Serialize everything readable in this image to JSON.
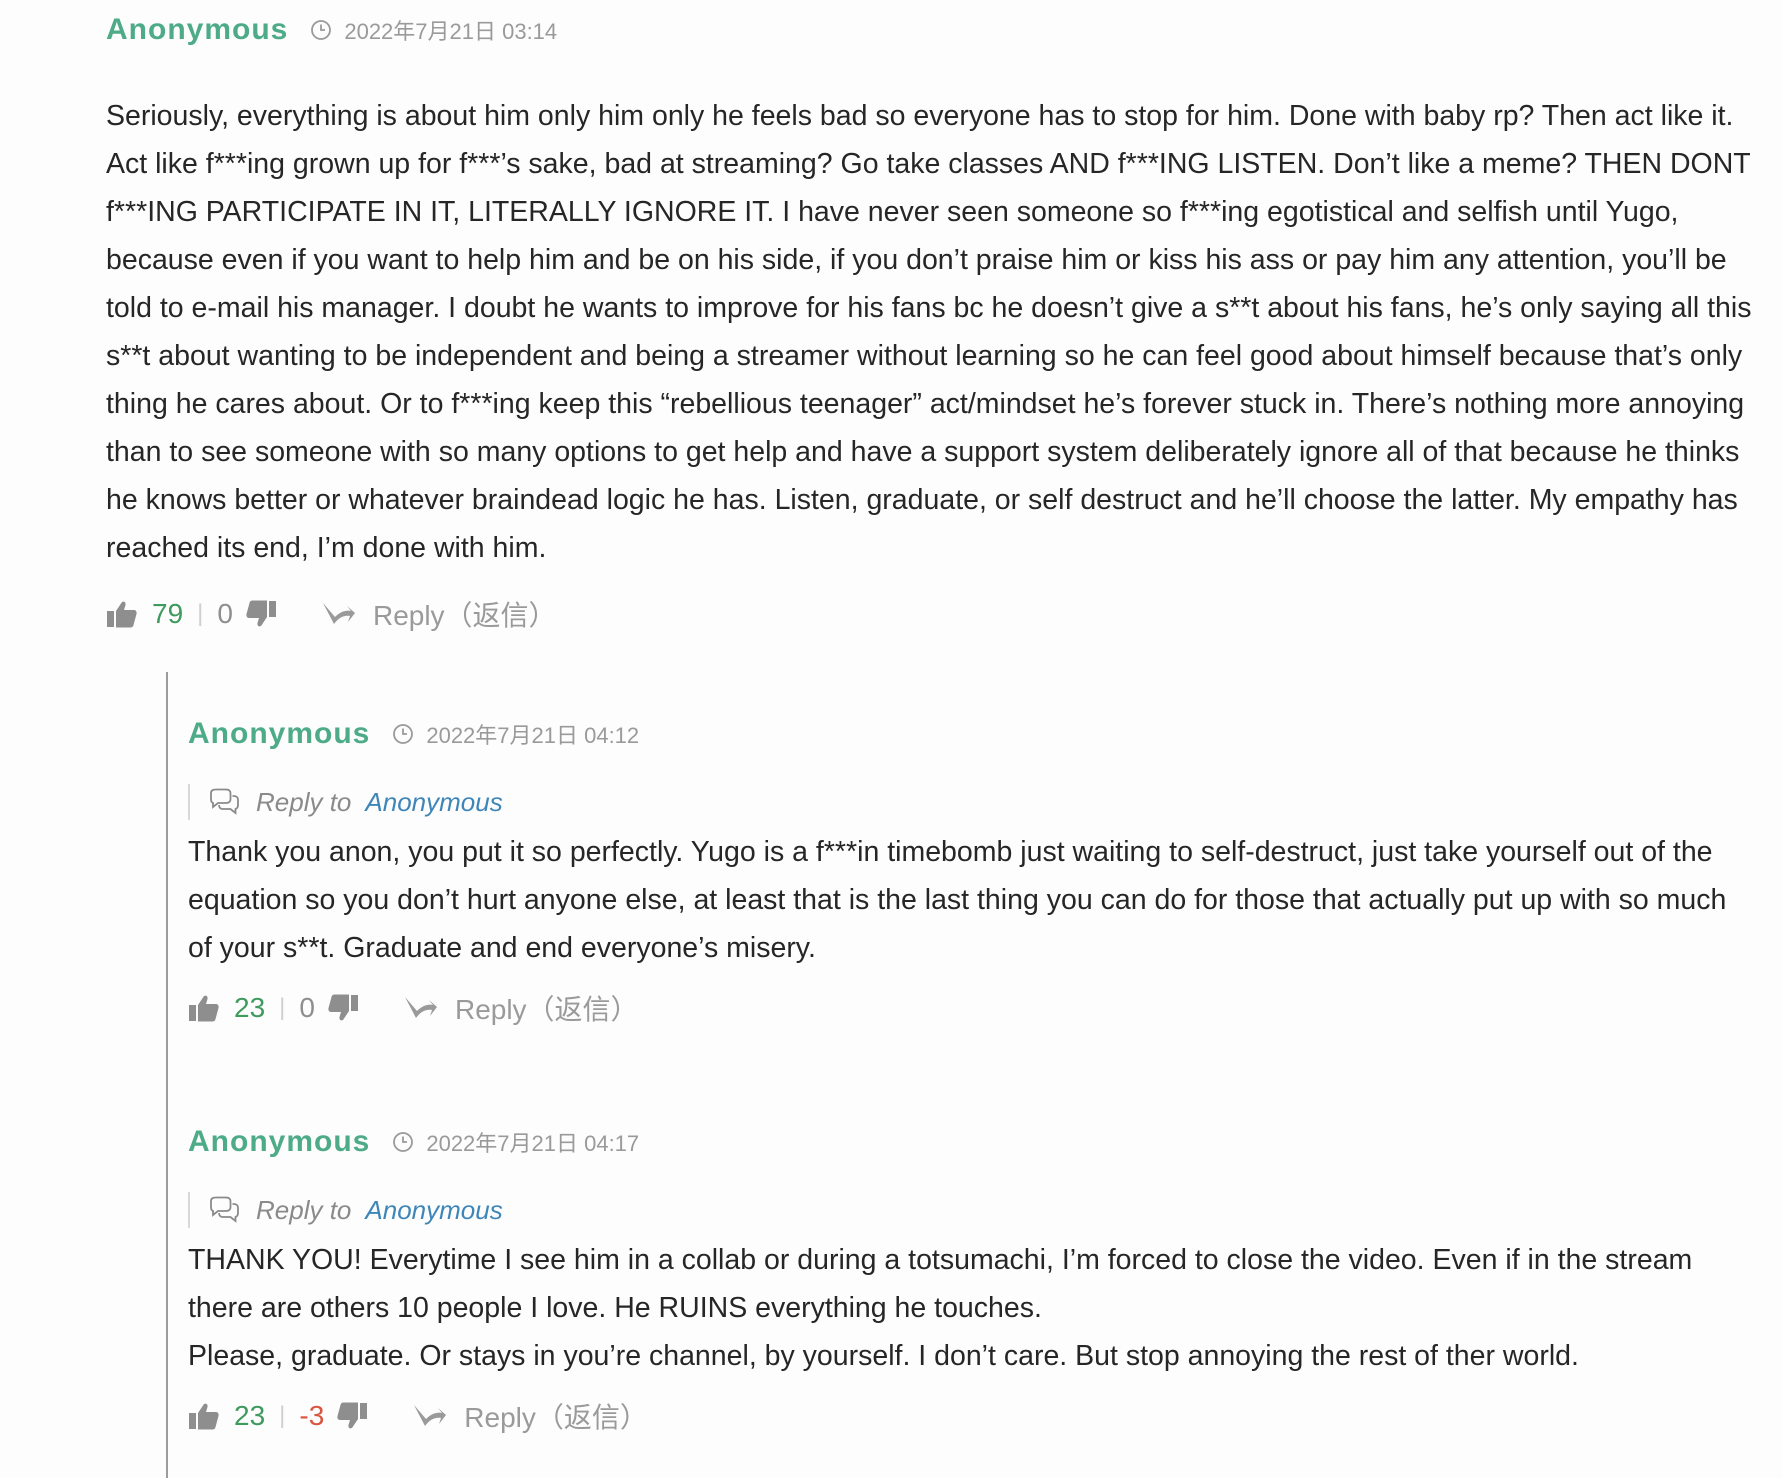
{
  "comments": [
    {
      "author": "Anonymous",
      "date": "2022年7月21日 03:14",
      "body": "Seriously, everything is about him only him only he feels bad so everyone has to stop for him. Done with baby rp? Then act like it. Act like f***ing grown up for f***’s sake, bad at streaming? Go take classes AND f***ING LISTEN. Don’t like a meme? THEN DONT f***ING PARTICIPATE IN IT, LITERALLY IGNORE IT. I have never seen someone so f***ing egotistical and selfish until Yugo, because even if you want to help him and be on his side, if you don’t praise him or kiss his ass or pay him any attention, you’ll be told to e-mail his manager. I doubt he wants to improve for his fans bc he doesn’t give a s**t about his fans, he’s only saying all this s**t about wanting to be independent and being a streamer without learning so he can feel good about himself because that’s only thing he cares about. Or to f***ing keep this “rebellious teenager” act/mindset he’s forever stuck in. There’s nothing more annoying than to see someone with so many options to get help and have a support system deliberately ignore all of that because he thinks he knows better or whatever braindead logic he has. Listen, graduate, or self destruct and he’ll choose the latter. My empathy has reached its end, I’m done with him.",
      "up": "79",
      "sep": "|",
      "down": "0",
      "reply_label": "Reply（返信）"
    },
    {
      "author": "Anonymous",
      "date": "2022年7月21日 04:12",
      "reply_to_label": "Reply to",
      "reply_to_target": "Anonymous",
      "body": "Thank you anon, you put it so perfectly. Yugo is a f***in timebomb just waiting to self-destruct, just take yourself out of the equation so you don’t hurt anyone else, at least that is the last thing you can do for those that actually put up with so much of your s**t. Graduate and end everyone’s misery.",
      "up": "23",
      "sep": "|",
      "down": "0",
      "reply_label": "Reply（返信）"
    },
    {
      "author": "Anonymous",
      "date": "2022年7月21日 04:17",
      "reply_to_label": "Reply to",
      "reply_to_target": "Anonymous",
      "body_line1": "THANK YOU! Everytime I see him in a collab or during a totsumachi, I’m forced to close the video. Even if in the stream there are others 10 people I love. He RUINS everything he touches.",
      "body_line2": "Please, graduate. Or stays in you’re channel, by yourself. I don’t care. But stop annoying the rest of ther world.",
      "up": "23",
      "sep": "|",
      "down": "-3",
      "reply_label": "Reply（返信）"
    }
  ],
  "colors": {
    "author": "#4dab87",
    "upvote": "#3f9a5e",
    "downvote_negative": "#d9553f",
    "reply_to_link": "#3f86b8",
    "meta": "#9a9a9a"
  },
  "icons": {
    "clock": "clock-icon",
    "thumb_up": "thumbs-up-icon",
    "thumb_down": "thumbs-down-icon",
    "reply": "reply-arrow-icon",
    "reply_to": "speech-bubbles-icon"
  }
}
